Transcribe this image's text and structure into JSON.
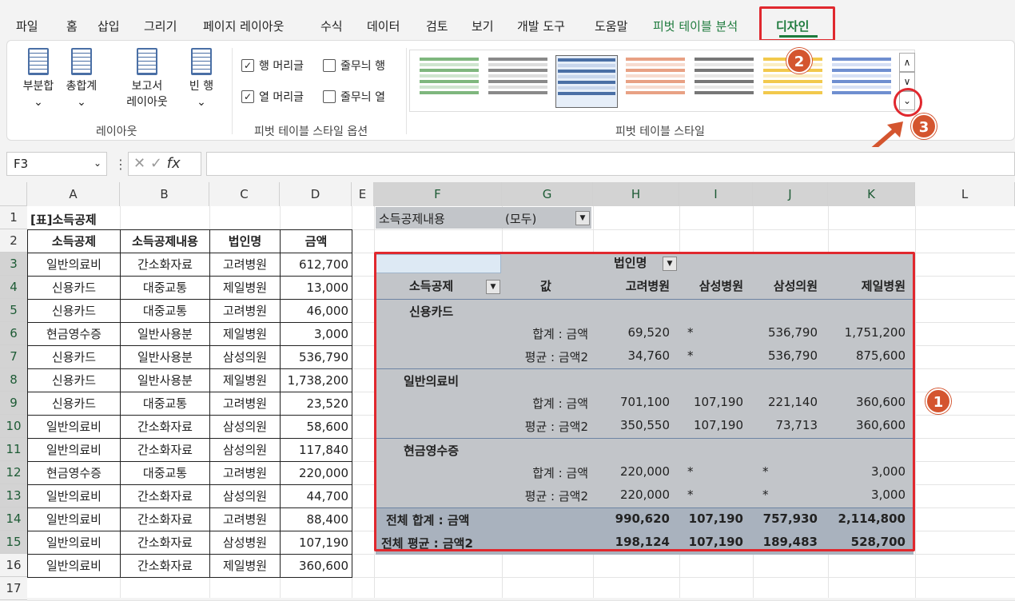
{
  "tabs": [
    "파일",
    "홈",
    "삽입",
    "그리기",
    "페이지 레이아웃",
    "수식",
    "데이터",
    "검토",
    "보기",
    "개발 도구",
    "도움말",
    "피벗 테이블 분석",
    "디자인"
  ],
  "ribbon": {
    "layout_group": {
      "subtotal": "부분합",
      "grandtotal": "총합계",
      "report1": "보고서",
      "report2": "레이아웃",
      "blank": "빈 행",
      "label": "레이아웃"
    },
    "options_group": {
      "row_headers": "행 머리글",
      "col_headers": "열 머리글",
      "banded_rows": "줄무늬 행",
      "banded_cols": "줄무늬 열",
      "label": "피벗 테이블 스타일 옵션"
    },
    "styles_group": {
      "label": "피벗 테이블 스타일"
    },
    "chevron": "⌄"
  },
  "badges": {
    "b1": "1",
    "b2": "2",
    "b3": "3"
  },
  "namebox": "F3",
  "fx": "fx",
  "columns": [
    "A",
    "B",
    "C",
    "D",
    "E",
    "F",
    "G",
    "H",
    "I",
    "J",
    "K",
    "L"
  ],
  "rows": [
    "1",
    "2",
    "3",
    "4",
    "5",
    "6",
    "7",
    "8",
    "9",
    "10",
    "11",
    "12",
    "13",
    "14",
    "15",
    "16",
    "17"
  ],
  "table": {
    "title": "[표]소득공제",
    "headers": [
      "소득공제",
      "소득공제내용",
      "법인명",
      "금액"
    ],
    "data": [
      [
        "일반의료비",
        "간소화자료",
        "고려병원",
        "612,700"
      ],
      [
        "신용카드",
        "대중교통",
        "제일병원",
        "13,000"
      ],
      [
        "신용카드",
        "대중교통",
        "고려병원",
        "46,000"
      ],
      [
        "현금영수증",
        "일반사용분",
        "제일병원",
        "3,000"
      ],
      [
        "신용카드",
        "일반사용분",
        "삼성의원",
        "536,790"
      ],
      [
        "신용카드",
        "일반사용분",
        "제일병원",
        "1,738,200"
      ],
      [
        "신용카드",
        "대중교통",
        "고려병원",
        "23,520"
      ],
      [
        "일반의료비",
        "간소화자료",
        "삼성의원",
        "58,600"
      ],
      [
        "일반의료비",
        "간소화자료",
        "삼성의원",
        "117,840"
      ],
      [
        "현금영수증",
        "대중교통",
        "고려병원",
        "220,000"
      ],
      [
        "일반의료비",
        "간소화자료",
        "삼성의원",
        "44,700"
      ],
      [
        "일반의료비",
        "간소화자료",
        "고려병원",
        "88,400"
      ],
      [
        "일반의료비",
        "간소화자료",
        "삼성병원",
        "107,190"
      ],
      [
        "일반의료비",
        "간소화자료",
        "제일병원",
        "360,600"
      ]
    ]
  },
  "pivot": {
    "filter_label": "소득공제내용",
    "filter_value": "(모두)",
    "col_field": "법인명",
    "row_field": "소득공제",
    "value_label": "값",
    "col_items": [
      "고려병원",
      "삼성병원",
      "삼성의원",
      "제일병원"
    ],
    "groups": [
      {
        "name": "신용카드",
        "rows": [
          {
            "label": "합계 : 금액",
            "values": [
              "69,520",
              "*",
              "536,790",
              "1,751,200"
            ]
          },
          {
            "label": "평균 : 금액2",
            "values": [
              "34,760",
              "*",
              "536,790",
              "875,600"
            ]
          }
        ]
      },
      {
        "name": "일반의료비",
        "rows": [
          {
            "label": "합계 : 금액",
            "values": [
              "701,100",
              "107,190",
              "221,140",
              "360,600"
            ]
          },
          {
            "label": "평균 : 금액2",
            "values": [
              "350,550",
              "107,190",
              "73,713",
              "360,600"
            ]
          }
        ]
      },
      {
        "name": "현금영수증",
        "rows": [
          {
            "label": "합계 : 금액",
            "values": [
              "220,000",
              "*",
              "*",
              "3,000"
            ]
          },
          {
            "label": "평균 : 금액2",
            "values": [
              "220,000",
              "*",
              "*",
              "3,000"
            ]
          }
        ]
      }
    ],
    "totals": [
      {
        "label": "전체 합계 : 금액",
        "values": [
          "990,620",
          "107,190",
          "757,930",
          "2,114,800"
        ]
      },
      {
        "label": "전체 평균 : 금액2",
        "values": [
          "198,124",
          "107,190",
          "189,483",
          "528,700"
        ]
      }
    ]
  }
}
